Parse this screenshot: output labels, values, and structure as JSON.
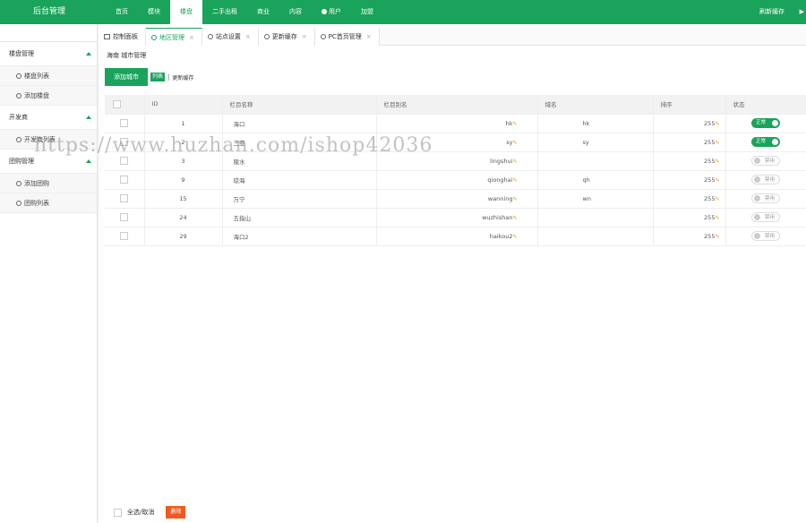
{
  "topbar": {
    "logo": "后台管理",
    "nav": [
      {
        "label": "首页",
        "active": false
      },
      {
        "label": "模块",
        "active": false
      },
      {
        "label": "楼盘",
        "active": true
      },
      {
        "label": "二手出租",
        "active": false
      },
      {
        "label": "商业",
        "active": false
      },
      {
        "label": "内容",
        "active": false
      },
      {
        "label": "用户",
        "active": false,
        "icon": "user-icon"
      },
      {
        "label": "加盟",
        "active": false
      }
    ],
    "refresh": "刷新缓存"
  },
  "sidebar": {
    "groups": [
      {
        "label": "楼盘管理",
        "items": [
          "楼盘列表",
          "添加楼盘"
        ]
      },
      {
        "label": "开发商",
        "items": [
          "开发商列表"
        ]
      },
      {
        "label": "团购管理",
        "items": [
          "添加团购",
          "团购列表"
        ]
      }
    ]
  },
  "tabs": [
    {
      "label": "控制面板",
      "icon": "home-icon",
      "active": false,
      "closable": false
    },
    {
      "label": "地区管理",
      "icon": "circle-icon",
      "active": true,
      "closable": true
    },
    {
      "label": "站点设置",
      "icon": "circle-icon",
      "active": false,
      "closable": true
    },
    {
      "label": "更新缓存",
      "icon": "circle-icon",
      "active": false,
      "closable": true
    },
    {
      "label": "PC首页管理",
      "icon": "circle-icon",
      "active": false,
      "closable": true
    }
  ],
  "breadcrumb": "海南 城市管理",
  "actions": {
    "add": "添加城市",
    "list": "列表",
    "sep": "|",
    "cache": "更新缓存"
  },
  "table": {
    "headers": [
      "",
      "ID",
      "栏目名称",
      "栏目别名",
      "域名",
      "排序",
      "状态"
    ],
    "rows": [
      {
        "id": "1",
        "name": "海口",
        "alias": "hk",
        "domain": "hk",
        "sort": "255",
        "status": "正常",
        "on": true
      },
      {
        "id": "2",
        "name": "三亚",
        "alias": "sy",
        "domain": "sy",
        "sort": "255",
        "status": "正常",
        "on": true
      },
      {
        "id": "3",
        "name": "陵水",
        "alias": "lingshui",
        "domain": "",
        "sort": "255",
        "status": "禁用",
        "on": false
      },
      {
        "id": "9",
        "name": "琼海",
        "alias": "qionghai",
        "domain": "qh",
        "sort": "255",
        "status": "禁用",
        "on": false
      },
      {
        "id": "15",
        "name": "万宁",
        "alias": "wanning",
        "domain": "wn",
        "sort": "255",
        "status": "禁用",
        "on": false
      },
      {
        "id": "24",
        "name": "五指山",
        "alias": "wuzhishan",
        "domain": "",
        "sort": "255",
        "status": "禁用",
        "on": false
      },
      {
        "id": "29",
        "name": "海口2",
        "alias": "haikou2",
        "domain": "",
        "sort": "255",
        "status": "禁用",
        "on": false
      }
    ]
  },
  "watermark": "https://www.huzhan.com/ishop42036",
  "footer": {
    "select_all": "全选/取消",
    "delete": "删除"
  },
  "colors": {
    "brand": "#1aa35a",
    "danger": "#f05a22",
    "pencil": "#e0a400"
  }
}
